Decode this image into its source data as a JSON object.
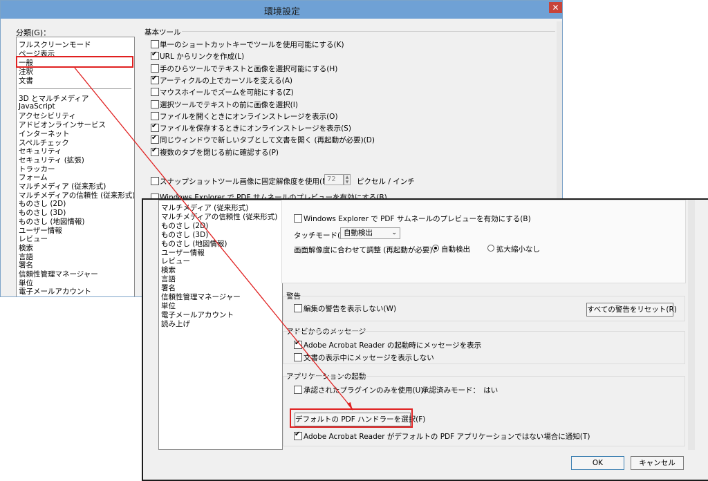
{
  "win1": {
    "title": "環境設定",
    "close_label": "✕",
    "category_label": "分類(G)：",
    "top_list": [
      "フルスクリーンモード",
      "ページ表示",
      "一般",
      "注釈",
      "文書"
    ],
    "bottom_list": [
      "3D とマルチメディア",
      "JavaScript",
      "アクセシビリティ",
      "アドビオンラインサービス",
      "インターネット",
      "スペルチェック",
      "セキュリティ",
      "セキュリティ (拡張)",
      "トラッカー",
      "フォーム",
      "マルチメディア (従来形式)",
      "マルチメディアの信頼性 (従来形式)",
      "ものさし (2D)",
      "ものさし (3D)",
      "ものさし (地図情報)",
      "ユーザー情報",
      "レビュー",
      "検索",
      "言語",
      "署名",
      "信頼性管理マネージャー",
      "単位",
      "電子メールアカウント"
    ],
    "basic_tools_label": "基本ツール",
    "options": [
      {
        "label": "単一のショートカットキーでツールを使用可能にする(K)",
        "checked": false
      },
      {
        "label": "URL からリンクを作成(L)",
        "checked": true
      },
      {
        "label": "手のひらツールでテキストと画像を選択可能にする(H)",
        "checked": false
      },
      {
        "label": "アーティクルの上でカーソルを変える(A)",
        "checked": true
      },
      {
        "label": "マウスホイールでズームを可能にする(Z)",
        "checked": false
      },
      {
        "label": "選択ツールでテキストの前に画像を選択(I)",
        "checked": false
      },
      {
        "label": "ファイルを開くときにオンラインストレージを表示(O)",
        "checked": false
      },
      {
        "label": "ファイルを保存するときにオンラインストレージを表示(S)",
        "checked": true
      },
      {
        "label": "同じウィンドウで新しいタブとして文書を開く (再起動が必要)(D)",
        "checked": true
      },
      {
        "label": "複数のタブを閉じる前に確認する(P)",
        "checked": true
      }
    ],
    "snapshot_label": "スナップショットツール画像に固定解像度を使用(N)：",
    "snapshot_value": "72",
    "snapshot_unit": "ピクセル / インチ",
    "thumb_label": "Windows Explorer で PDF サムネールのプレビューを有効にする(B)"
  },
  "win2": {
    "list": [
      "マルチメディア (従来形式)",
      "マルチメディアの信頼性 (従来形式)",
      "ものさし (2D)",
      "ものさし (3D)",
      "ものさし (地図情報)",
      "ユーザー情報",
      "レビュー",
      "検索",
      "言語",
      "署名",
      "信頼性管理マネージャー",
      "単位",
      "電子メールアカウント",
      "読み上げ"
    ],
    "thumb_label": "Windows Explorer で PDF サムネールのプレビューを有効にする(B)",
    "touch_label": "タッチモード(T)：",
    "touch_value": "自動検出",
    "scale_label": "画面解像度に合わせて調整 (再起動が必要)：",
    "scale_auto": "自動検出",
    "scale_none": "拡大縮小なし",
    "warnings_title": "警告",
    "warnings_cb": "編集の警告を表示しない(W)",
    "reset_button": "すべての警告をリセット(R)",
    "messages_title": "アドビからのメッセージ",
    "msg1": "Adobe Acrobat Reader の起動時にメッセージを表示",
    "msg2": "文書の表示中にメッセージを表示しない",
    "startup_title": "アプリケーションの起動",
    "plugins_cb": "承認されたプラグインのみを使用(U)",
    "certified_mode": "承認済みモード：　はい",
    "default_handler_button": "デフォルトの PDF ハンドラーを選択(F)",
    "notify_cb": "Adobe Acrobat Reader がデフォルトの PDF アプリケーションではない場合に通知(T)",
    "ok_button": "OK",
    "cancel_button": "キャンセル"
  },
  "colors": {
    "annotation": "#e02020",
    "titlebar": "#6fa1d5"
  }
}
